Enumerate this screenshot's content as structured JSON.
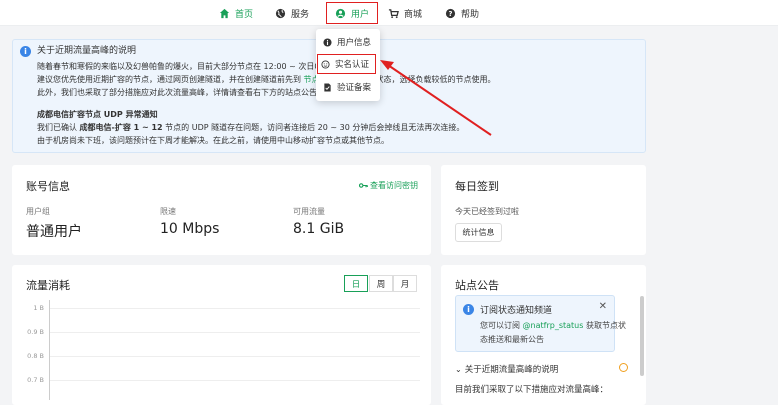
{
  "nav": {
    "home": "首页",
    "service": "服务",
    "user": "用户",
    "shop": "商城",
    "help": "帮助"
  },
  "dropdown": {
    "items": [
      "用户信息",
      "实名认证",
      "验证备案"
    ]
  },
  "notice": {
    "title": "关于近期流量高峰的说明",
    "line1": "随着春节和寒假的来临以及幻兽帕鲁的爆火，目前大部分节点在 12:00 ~ 次日01",
    "line2a": "建议您优先使用近期扩容的节点，通过网页创建隧道，并在创建隧道前先到 ",
    "line2link": "节点",
    "line2b": "状态，选择负载较低的节点使用。",
    "line3a": "此外，我们也采取了部分措施应对此次流量高峰，详情请查看右下方的站点公告",
    "line3b": "。",
    "section_title": "成都电信扩容节点 UDP 异常通知",
    "line4a": "我们已确认 ",
    "line4bold": "成都电信-扩容 1 ~ 12",
    "line4b": " 节点的 UDP 隧道存在问题，访问者连接后 20 ~ 30 分钟后会掉线且无法再次连接。",
    "line5": "由于机房尚未下班，该问题预计在下周才能解决。在此之前，请使用中山移动扩容节点或其他节点。"
  },
  "account": {
    "title": "账号信息",
    "view_key": "查看访问密钥",
    "group_label": "用户组",
    "group_value": "普通用户",
    "speed_label": "限速",
    "speed_value": "10 Mbps",
    "traffic_label": "可用流量",
    "traffic_value": "8.1 GiB"
  },
  "checkin": {
    "title": "每日签到",
    "status": "今天已经签到过啦",
    "stats_button": "统计信息"
  },
  "traffic": {
    "title": "流量消耗",
    "tabs": [
      "日",
      "周",
      "月"
    ],
    "active_tab": "日"
  },
  "chart_data": {
    "type": "line",
    "title": "流量消耗",
    "y_ticks": [
      "1 B",
      "0.9 B",
      "0.8 B",
      "0.7 B"
    ],
    "series": []
  },
  "announce": {
    "title": "站点公告",
    "sub_title": "订阅状态通知频道",
    "sub_text1": "您可以订阅 ",
    "sub_handle": "@natfrp_status",
    "sub_text2": " 获取节点状",
    "sub_text3": "态推送和最新公告",
    "item_title": "关于近期流量高峰的说明",
    "item_text": "目前我们采取了以下措施应对流量高峰："
  },
  "colors": {
    "accent": "#18a058",
    "highlight": "#e02020",
    "info": "#3a85e6"
  }
}
